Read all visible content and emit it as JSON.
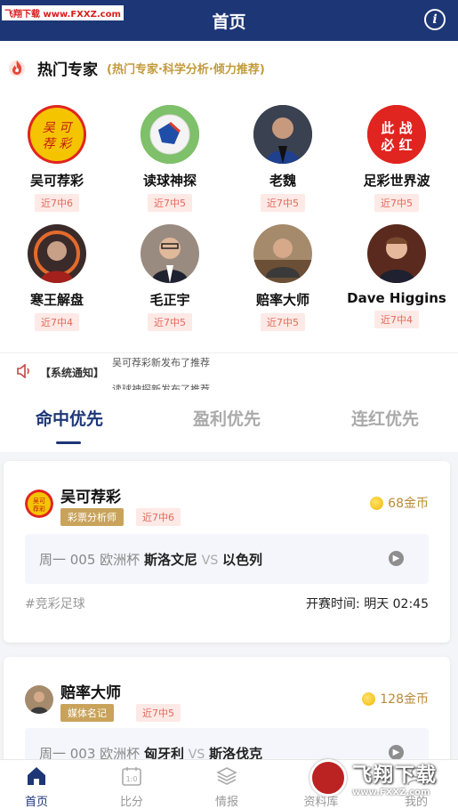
{
  "header": {
    "title": "首页",
    "info_icon": "info-icon"
  },
  "watermark_top": "飞翔下载 www.FXXZ.com",
  "experts_section": {
    "title": "热门专家",
    "subtitle": "(热门专家·科学分析·倾力推荐)",
    "items": [
      {
        "name": "吴可荐彩",
        "badge": "近7中6",
        "avatar_text": "吴可荐彩",
        "color": "#d8261f"
      },
      {
        "name": "读球神探",
        "badge": "近7中5",
        "avatar_text": "",
        "color": "#3b8b3b"
      },
      {
        "name": "老魏",
        "badge": "近7中5",
        "avatar_text": "",
        "color": "#3a3d47"
      },
      {
        "name": "足彩世界波",
        "badge": "近7中5",
        "avatar_text": "此战必红",
        "color": "#e0241f"
      },
      {
        "name": "寒王解盘",
        "badge": "近7中4",
        "avatar_text": "",
        "color": "#8a3a22"
      },
      {
        "name": "毛正宇",
        "badge": "近7中5",
        "avatar_text": "",
        "color": "#6b5c52"
      },
      {
        "name": "赔率大师",
        "badge": "近7中5",
        "avatar_text": "",
        "color": "#7c6a57"
      },
      {
        "name": "Dave Higgins",
        "badge": "近7中4",
        "avatar_text": "",
        "color": "#6a3424"
      }
    ]
  },
  "notice": {
    "tag": "【系统通知】",
    "line1": "吴可荐彩新发布了推荐",
    "line2": "读球神探新发布了推荐"
  },
  "tabs": [
    {
      "label": "命中优先",
      "active": true
    },
    {
      "label": "盈利优先",
      "active": false
    },
    {
      "label": "连红优先",
      "active": false
    }
  ],
  "cards": [
    {
      "name": "吴可荐彩",
      "tag": "彩票分析师",
      "badge": "近7中6",
      "coins": "68金币",
      "match_prefix": "周一 005 欧洲杯",
      "home": "斯洛文尼",
      "vs": "VS",
      "away": "以色列",
      "type": "#竞彩足球",
      "time": "开赛时间: 明天 02:45"
    },
    {
      "name": "赔率大师",
      "tag": "媒体名记",
      "badge": "近7中5",
      "coins": "128金币",
      "match_prefix": "周一 003 欧洲杯",
      "home": "匈牙利",
      "vs": "VS",
      "away": "斯洛伐克"
    }
  ],
  "bottom_nav": [
    {
      "label": "首页",
      "icon": "home-icon",
      "active": true
    },
    {
      "label": "比分",
      "icon": "scoreboard-icon",
      "active": false
    },
    {
      "label": "情报",
      "icon": "layers-icon",
      "active": false
    },
    {
      "label": "资料库",
      "icon": "database-icon",
      "active": false
    },
    {
      "label": "我的",
      "icon": "user-icon",
      "active": false
    }
  ],
  "watermark_bottom": {
    "text": "飞翔下载",
    "url": "www.FXXZ.com"
  },
  "colors": {
    "primary": "#1d3676",
    "gold": "#c9a35c",
    "badge_red": "#e26a5a"
  }
}
